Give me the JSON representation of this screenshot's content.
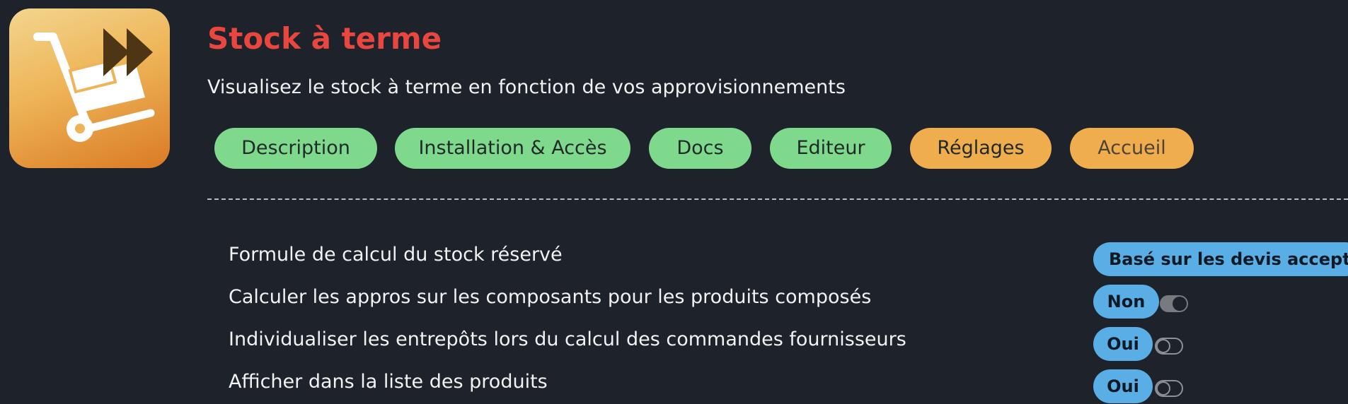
{
  "app": {
    "title": "Stock à terme",
    "subtitle": "Visualisez le stock à terme en fonction de vos approvisionnements",
    "logo_icon": "hand-truck-fast-forward-icon"
  },
  "tabs": [
    {
      "label": "Description",
      "color": "#7fd98c"
    },
    {
      "label": "Installation & Accès",
      "color": "#7fd98c"
    },
    {
      "label": "Docs",
      "color": "#7fd98c"
    },
    {
      "label": "Editeur",
      "color": "#7fd98c"
    },
    {
      "label": "Réglages",
      "color": "#f0ad4e"
    },
    {
      "label": "Accueil",
      "color": "#f0ad4e"
    }
  ],
  "settings": [
    {
      "label": "Formule de calcul du stock réservé",
      "value": "Basé sur les devis acceptés e"
    },
    {
      "label": "Calculer les appros sur les composants pour les produits composés",
      "value": "Non",
      "toggle": "on"
    },
    {
      "label": "Individualiser les entrepôts lors du calcul des commandes fournisseurs",
      "value": "Oui",
      "toggle": "off"
    },
    {
      "label": "Afficher dans la liste des produits",
      "value": "Oui",
      "toggle": "off"
    }
  ],
  "colors": {
    "background": "#1e222b",
    "title": "#e8463f",
    "pill": "#5aaee6"
  }
}
